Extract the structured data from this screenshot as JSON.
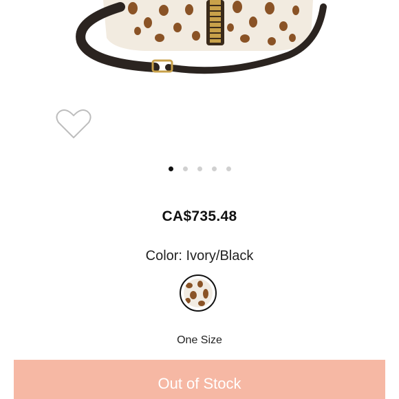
{
  "product": {
    "price": "CA$735.48",
    "color_label": "Color:",
    "color_value": "Ivory/Black",
    "size": "One Size",
    "button_label": "Out of Stock",
    "image_icon": "leopard-print-handbag",
    "wishlist_icon": "heart-outline-icon"
  },
  "carousel": {
    "total": 5,
    "active_index": 0
  },
  "colors": {
    "button_bg": "#f6b8a4",
    "active_dot": "#111111",
    "inactive_dot": "#d0d0d0"
  }
}
